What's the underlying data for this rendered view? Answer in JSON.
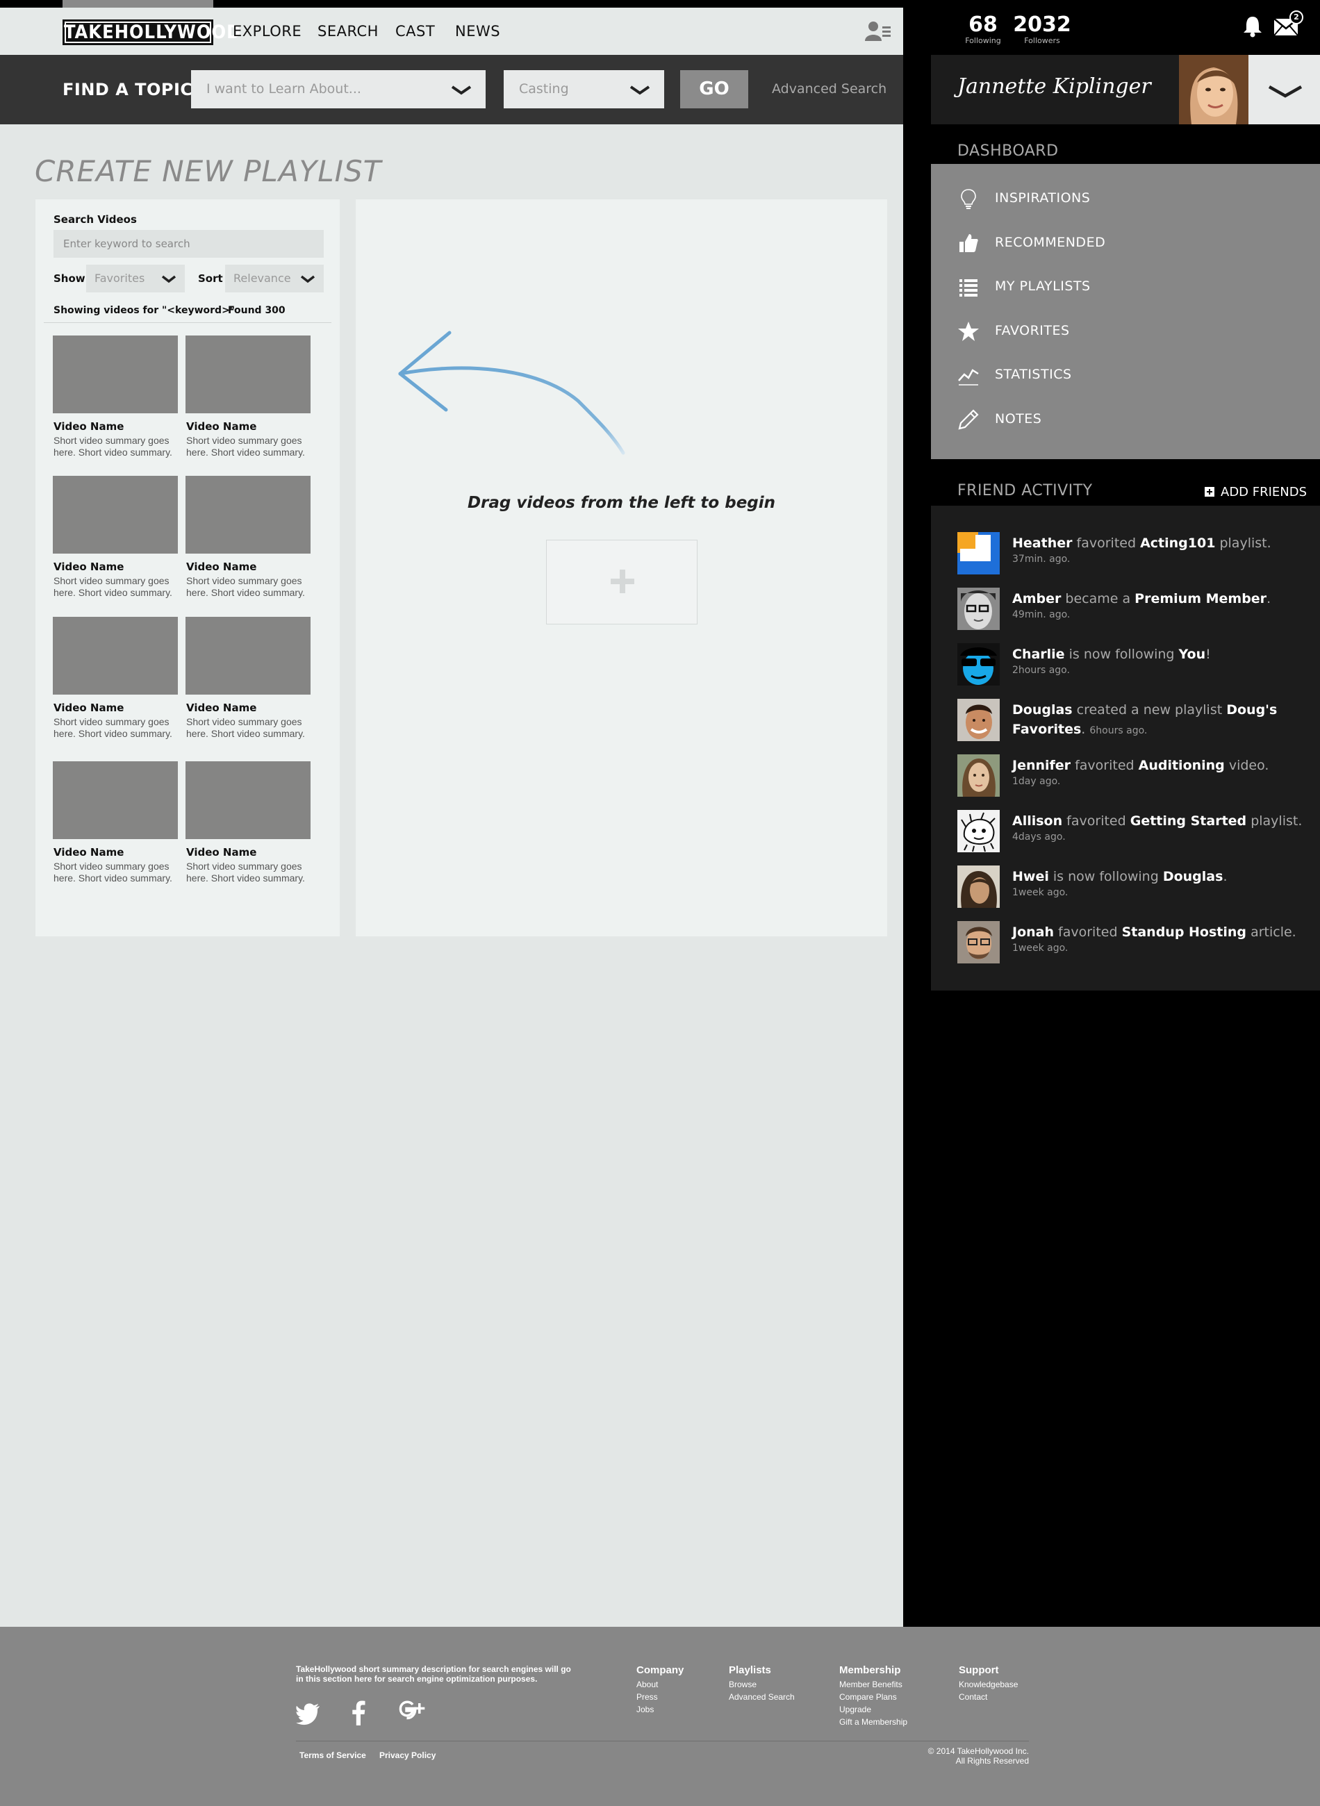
{
  "header": {
    "logo": "TAKEHOLLYWOOD",
    "nav": [
      "EXPLORE",
      "SEARCH",
      "CAST",
      "NEWS"
    ]
  },
  "findbar": {
    "label": "FIND A TOPIC",
    "topic_placeholder": "I want to Learn About...",
    "casting_value": "Casting",
    "go_label": "GO",
    "advanced_search": "Advanced Search"
  },
  "page": {
    "title": "CREATE NEW PLAYLIST"
  },
  "search_panel": {
    "label": "Search Videos",
    "placeholder": "Enter keyword to search",
    "show_label": "Show",
    "show_value": "Favorites",
    "sort_label": "Sort",
    "sort_value": "Relevance",
    "showing_text": "Showing videos for \"<keyword>\"",
    "found_text": "Found 300",
    "videos": [
      {
        "name": "Video Name",
        "summary": "Short video summary goes here. Short video summary."
      },
      {
        "name": "Video Name",
        "summary": "Short video summary goes here. Short video summary."
      },
      {
        "name": "Video Name",
        "summary": "Short video summary goes here. Short video summary."
      },
      {
        "name": "Video Name",
        "summary": "Short video summary goes here. Short video summary."
      },
      {
        "name": "Video Name",
        "summary": "Short video summary goes here. Short video summary."
      },
      {
        "name": "Video Name",
        "summary": "Short video summary goes here. Short video summary."
      },
      {
        "name": "Video Name",
        "summary": "Short video summary goes here. Short video summary."
      },
      {
        "name": "Video Name",
        "summary": "Short video summary goes here. Short video summary."
      }
    ]
  },
  "drop_zone": {
    "instruction": "Drag videos from the left to begin"
  },
  "sidebar": {
    "following_count": "68",
    "following_label": "Following",
    "followers_count": "2032",
    "followers_label": "Followers",
    "mail_badge": "2",
    "user_name": "Jannette Kiplinger",
    "dashboard_title": "DASHBOARD",
    "dashboard_items": [
      {
        "label": "INSPIRATIONS",
        "icon": "lightbulb-icon"
      },
      {
        "label": "RECOMMENDED",
        "icon": "thumbs-up-icon"
      },
      {
        "label": "MY PLAYLISTS",
        "icon": "list-icon"
      },
      {
        "label": "FAVORITES",
        "icon": "star-icon"
      },
      {
        "label": "STATISTICS",
        "icon": "chart-line-icon"
      },
      {
        "label": "NOTES",
        "icon": "pencil-icon"
      }
    ],
    "friend_activity_title": "FRIEND ACTIVITY",
    "add_friends": "ADD FRIENDS",
    "activity": [
      {
        "user": "Heather",
        "verb": " favorited ",
        "object": "Acting101",
        "tail": " playlist.",
        "ago": "37min. ago."
      },
      {
        "user": "Amber",
        "verb": " became a ",
        "object": "Premium Member",
        "tail": ".",
        "ago": "49min. ago."
      },
      {
        "user": "Charlie",
        "verb": " is now following ",
        "object": "You",
        "tail": "!",
        "ago": "2hours ago."
      },
      {
        "user": "Douglas",
        "verb": " created a new playlist ",
        "object": "Doug's Favorites",
        "tail": ".",
        "ago": "6hours ago."
      },
      {
        "user": "Jennifer",
        "verb": " favorited ",
        "object": "Auditioning",
        "tail": " video.",
        "ago": "1day ago."
      },
      {
        "user": "Allison",
        "verb": " favorited ",
        "object": "Getting Started",
        "tail": " playlist.",
        "ago": "4days ago."
      },
      {
        "user": "Hwei",
        "verb": " is now following ",
        "object": "Douglas",
        "tail": ".",
        "ago": "1week ago."
      },
      {
        "user": "Jonah",
        "verb": " favorited ",
        "object": "Standup Hosting",
        "tail": " article.",
        "ago": "1week ago."
      }
    ]
  },
  "footer": {
    "description": "TakeHollywood short summary description for  search engines will go in this section here for search engine optimization purposes.",
    "columns": [
      {
        "heading": "Company",
        "links": [
          "About",
          "Press",
          "Jobs"
        ]
      },
      {
        "heading": "Playlists",
        "links": [
          "Browse",
          "Advanced Search"
        ]
      },
      {
        "heading": "Membership",
        "links": [
          "Member Benefits",
          "Compare Plans",
          "Upgrade",
          "Gift a Membership"
        ]
      },
      {
        "heading": "Support",
        "links": [
          "Knowledgebase",
          "Contact"
        ]
      }
    ],
    "terms": "Terms of Service",
    "privacy": "Privacy Policy",
    "copyright_line1": "© 2014 TakeHollywood Inc.",
    "copyright_line2": "All Rights Reserved"
  },
  "colors": {
    "accent_arrow": "#7fb3d9",
    "sidebar_bg": "#000000",
    "dashboard_bg": "#878787",
    "footer_bg": "#878787"
  }
}
